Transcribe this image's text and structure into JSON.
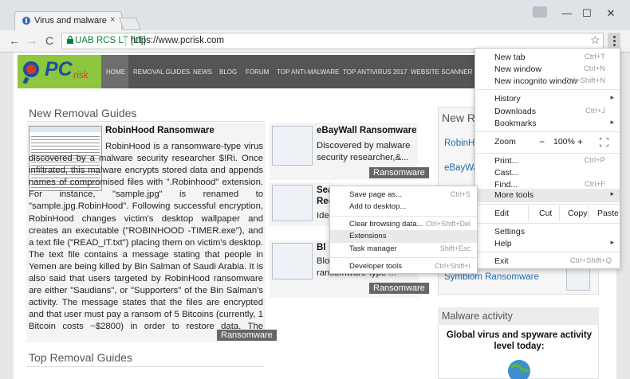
{
  "tab": {
    "title": "Virus and malware remo",
    "close": "×"
  },
  "window": {
    "minimize": "—",
    "maximize": "☐",
    "close": "✕"
  },
  "toolbar": {
    "back": "←",
    "forward": "→",
    "reload": "C",
    "secure_label": "UAB RCS LT [LT]",
    "url": "https://www.pcrisk.com",
    "star": "☆"
  },
  "site": {
    "logo_text": "PC",
    "logo_sub": "risk",
    "nav": [
      "HOME",
      "REMOVAL GUIDES",
      "NEWS",
      "BLOG",
      "FORUM",
      "TOP ANTI-MALWARE",
      "TOP ANTIVIRUS 2017",
      "WEBSITE SCANNER"
    ],
    "new_removal_heading": "New Removal Guides",
    "top_removal_heading": "Top Removal Guides",
    "article1": {
      "title": "RobinHood Ransomware",
      "text": "RobinHood is a ransomware-type virus discovered by a malware security researcher $!Ri. Once infiltrated, this malware encrypts stored data and appends names of compromised files with \".Robinhood\" extension. For instance, \"sample.jpg\" is renamed to \"sample.jpg.RobinHood\". Following successful encryption, RobinHood changes victim's desktop wallpaper and creates an executable (\"ROBINHOOD -TIMER.exe\"), and a text file (\"READ_IT.txt\") placing them on victim's desktop. The text file contains a message stating that people in Yemen are being killed by Bin Salman of Saudi Arabia. It is also said that users targeted by RobinHood ransomware are either \"Saudians\", or \"Supporters\" of the Bin Salman's activity. The message states that the files are encrypted and that user must pay a ransom of 5 Bitcoins (currently, 1 Bitcoin costs ~$2800) in order to restore data. The received money will supposedly be used to help vict...",
      "tag": "Ransomware"
    },
    "article2": {
      "title": "eBayWall Ransomware",
      "text": "Discovered by malware security researcher,&...",
      "tag": "Ransomware"
    },
    "article3": {
      "title": "Sea",
      "title2": "Rec",
      "text": "Iden"
    },
    "article4": {
      "title": "Bl",
      "text": "Blo",
      "text2": "ransomware-type ...",
      "tag": "Ransomware"
    },
    "sidebar": {
      "heading": "New Rem",
      "links": [
        "RobinHo",
        "eBayWal",
        "Symbiom Ransomware"
      ],
      "activity_heading": "Malware activity",
      "activity_title": "Global virus and spyware activity level today:"
    }
  },
  "menu": {
    "items": [
      {
        "label": "New tab",
        "shortcut": "Ctrl+T"
      },
      {
        "label": "New window",
        "shortcut": "Ctrl+N"
      },
      {
        "label": "New incognito window",
        "shortcut": "Ctrl+Shift+N"
      },
      {
        "label": "History",
        "arrow": "▸"
      },
      {
        "label": "Downloads",
        "shortcut": "Ctrl+J"
      },
      {
        "label": "Bookmarks",
        "arrow": "▸"
      },
      {
        "label": "Zoom",
        "minus": "−",
        "value": "100%",
        "plus": "+"
      },
      {
        "label": "Print...",
        "shortcut": "Ctrl+P"
      },
      {
        "label": "Cast..."
      },
      {
        "label": "Find...",
        "shortcut": "Ctrl+F"
      },
      {
        "label": "More tools",
        "arrow": "▸"
      },
      {
        "label": "Edit",
        "cut": "Cut",
        "copy": "Copy",
        "paste": "Paste"
      },
      {
        "label": "Settings"
      },
      {
        "label": "Help",
        "arrow": "▸"
      },
      {
        "label": "Exit",
        "shortcut": "Ctrl+Shift+Q"
      }
    ]
  },
  "submenu": {
    "items": [
      {
        "label": "Save page as...",
        "shortcut": "Ctrl+S"
      },
      {
        "label": "Add to desktop..."
      },
      {
        "label": "Clear browsing data...",
        "shortcut": "Ctrl+Shift+Del"
      },
      {
        "label": "Extensions"
      },
      {
        "label": "Task manager",
        "shortcut": "Shift+Esc"
      },
      {
        "label": "Developer tools",
        "shortcut": "Ctrl+Shift+I"
      }
    ]
  },
  "colors": {
    "logo_green": "#8dc63f",
    "nav_gray": "#555555",
    "secure_green": "#0b8043",
    "link_blue": "#1e6ab0"
  }
}
